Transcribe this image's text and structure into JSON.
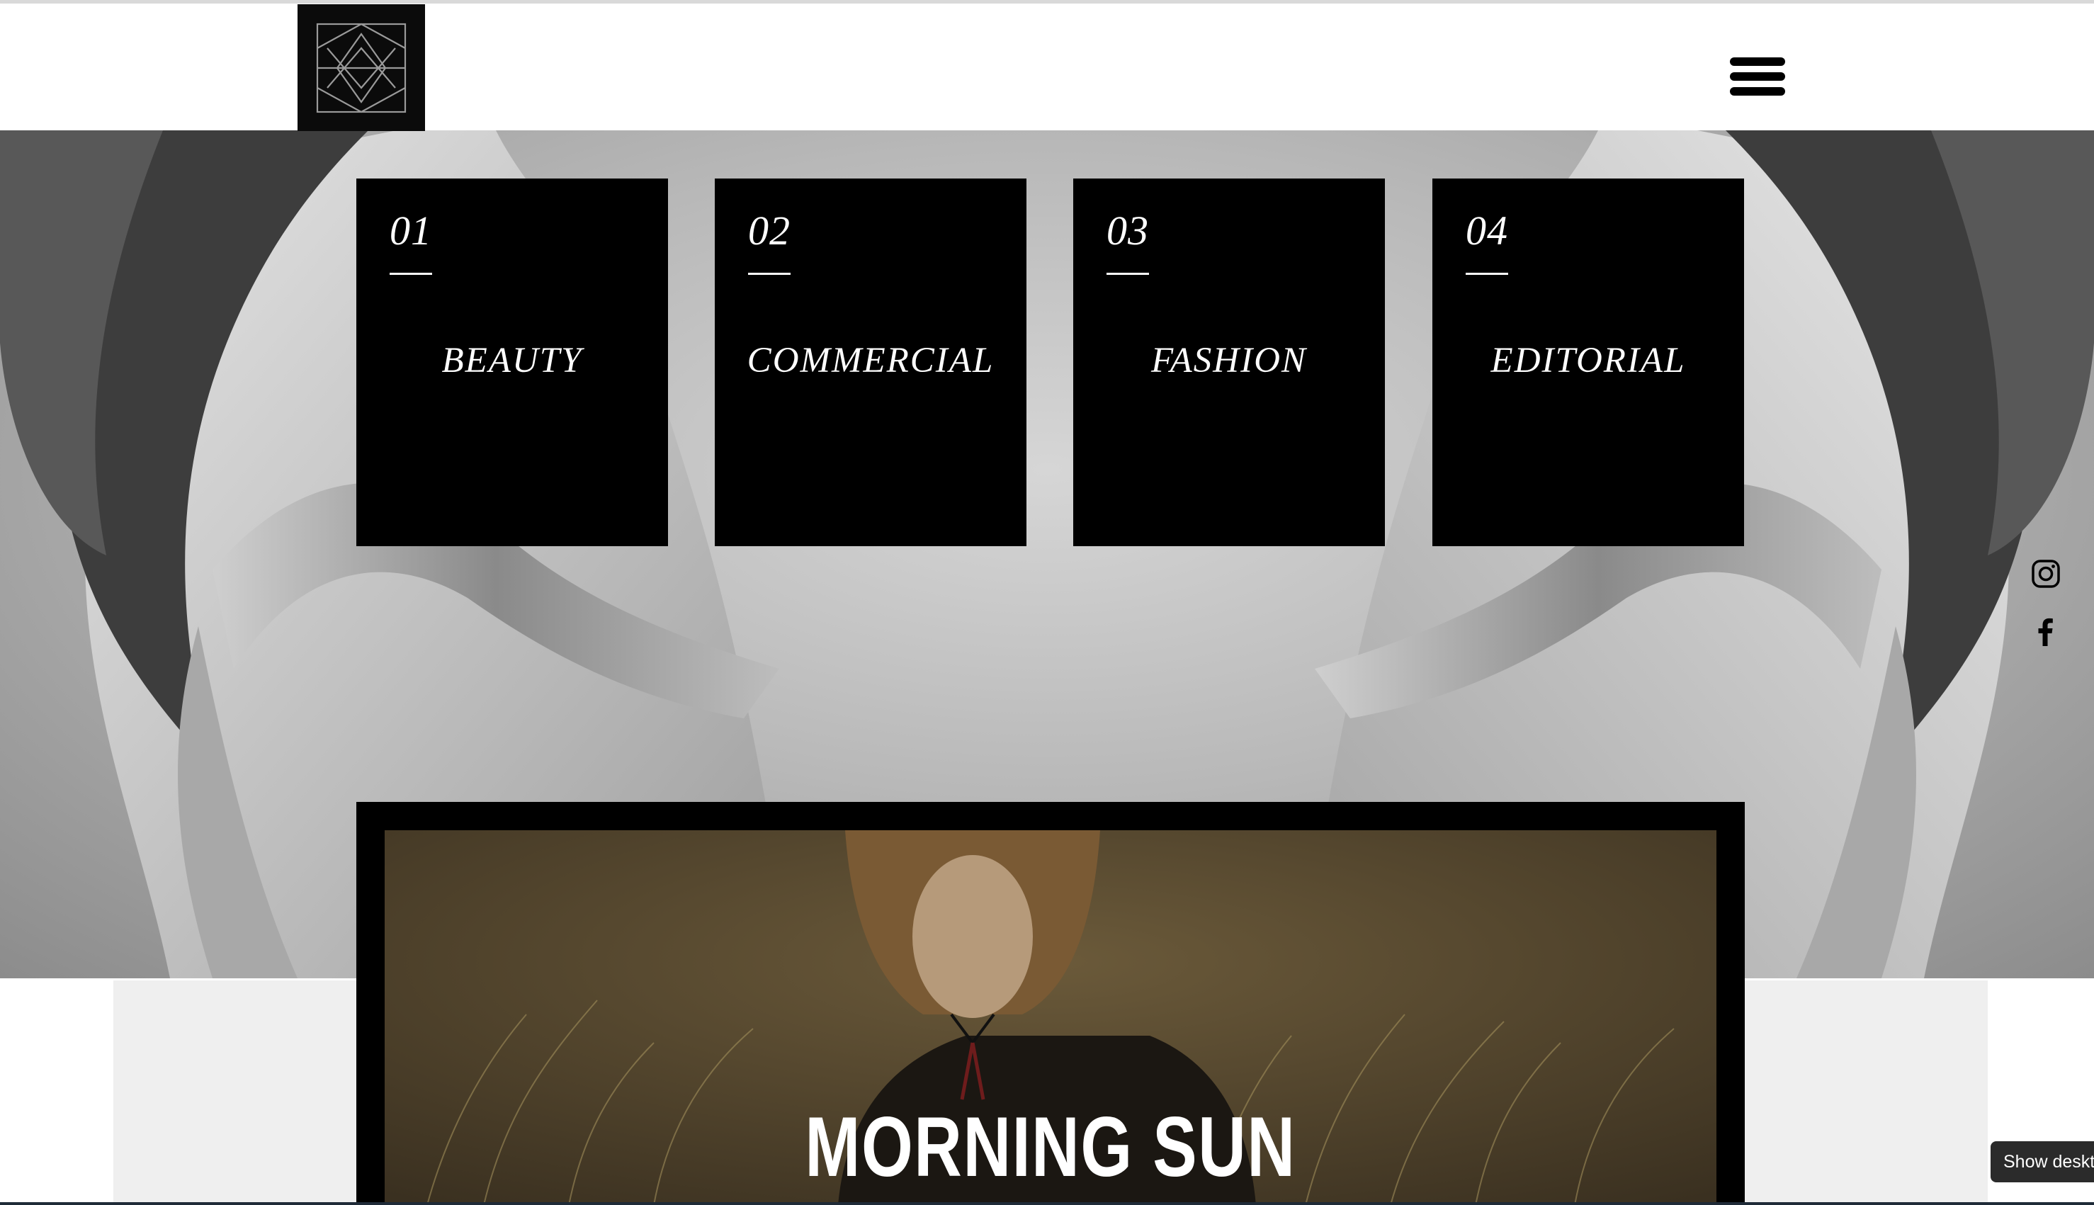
{
  "header": {
    "logo_icon": "monogram-logo-icon",
    "menu_icon": "hamburger-menu-icon"
  },
  "categories": [
    {
      "number": "01",
      "label": "BEAUTY"
    },
    {
      "number": "02",
      "label": "COMMERCIAL"
    },
    {
      "number": "03",
      "label": "FASHION"
    },
    {
      "number": "04",
      "label": "EDITORIAL"
    }
  ],
  "social": {
    "instagram_icon": "instagram-icon",
    "facebook_icon": "facebook-icon"
  },
  "video": {
    "title": "MORNING SUN"
  },
  "desktop_button": {
    "label": "Show deskto"
  },
  "colors": {
    "card_background": "#000000",
    "card_text": "#ffffff",
    "lower_background": "#efefef",
    "video_tint": "#5a4a30"
  }
}
